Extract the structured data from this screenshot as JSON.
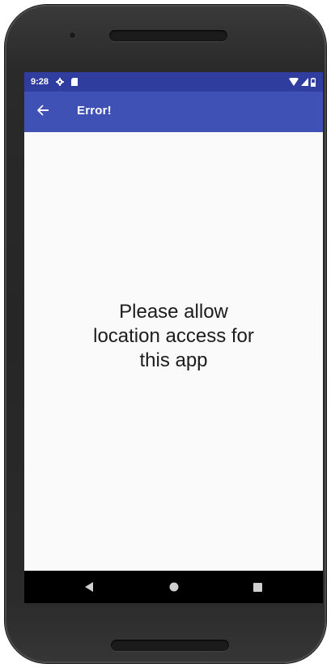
{
  "status_bar": {
    "time": "9:28",
    "left_icons": [
      "settings-icon",
      "sd-card-icon"
    ],
    "right_icons": [
      "wifi-icon",
      "signal-icon",
      "battery-icon"
    ]
  },
  "app_bar": {
    "title": "Error!",
    "back_icon": "arrow-back-icon",
    "color": "#3f51b5",
    "status_color": "#2f3e9e"
  },
  "content": {
    "message": "Please allow location access for this app"
  },
  "nav_bar": {
    "buttons": [
      "back-triangle-icon",
      "home-circle-icon",
      "recents-square-icon"
    ]
  }
}
